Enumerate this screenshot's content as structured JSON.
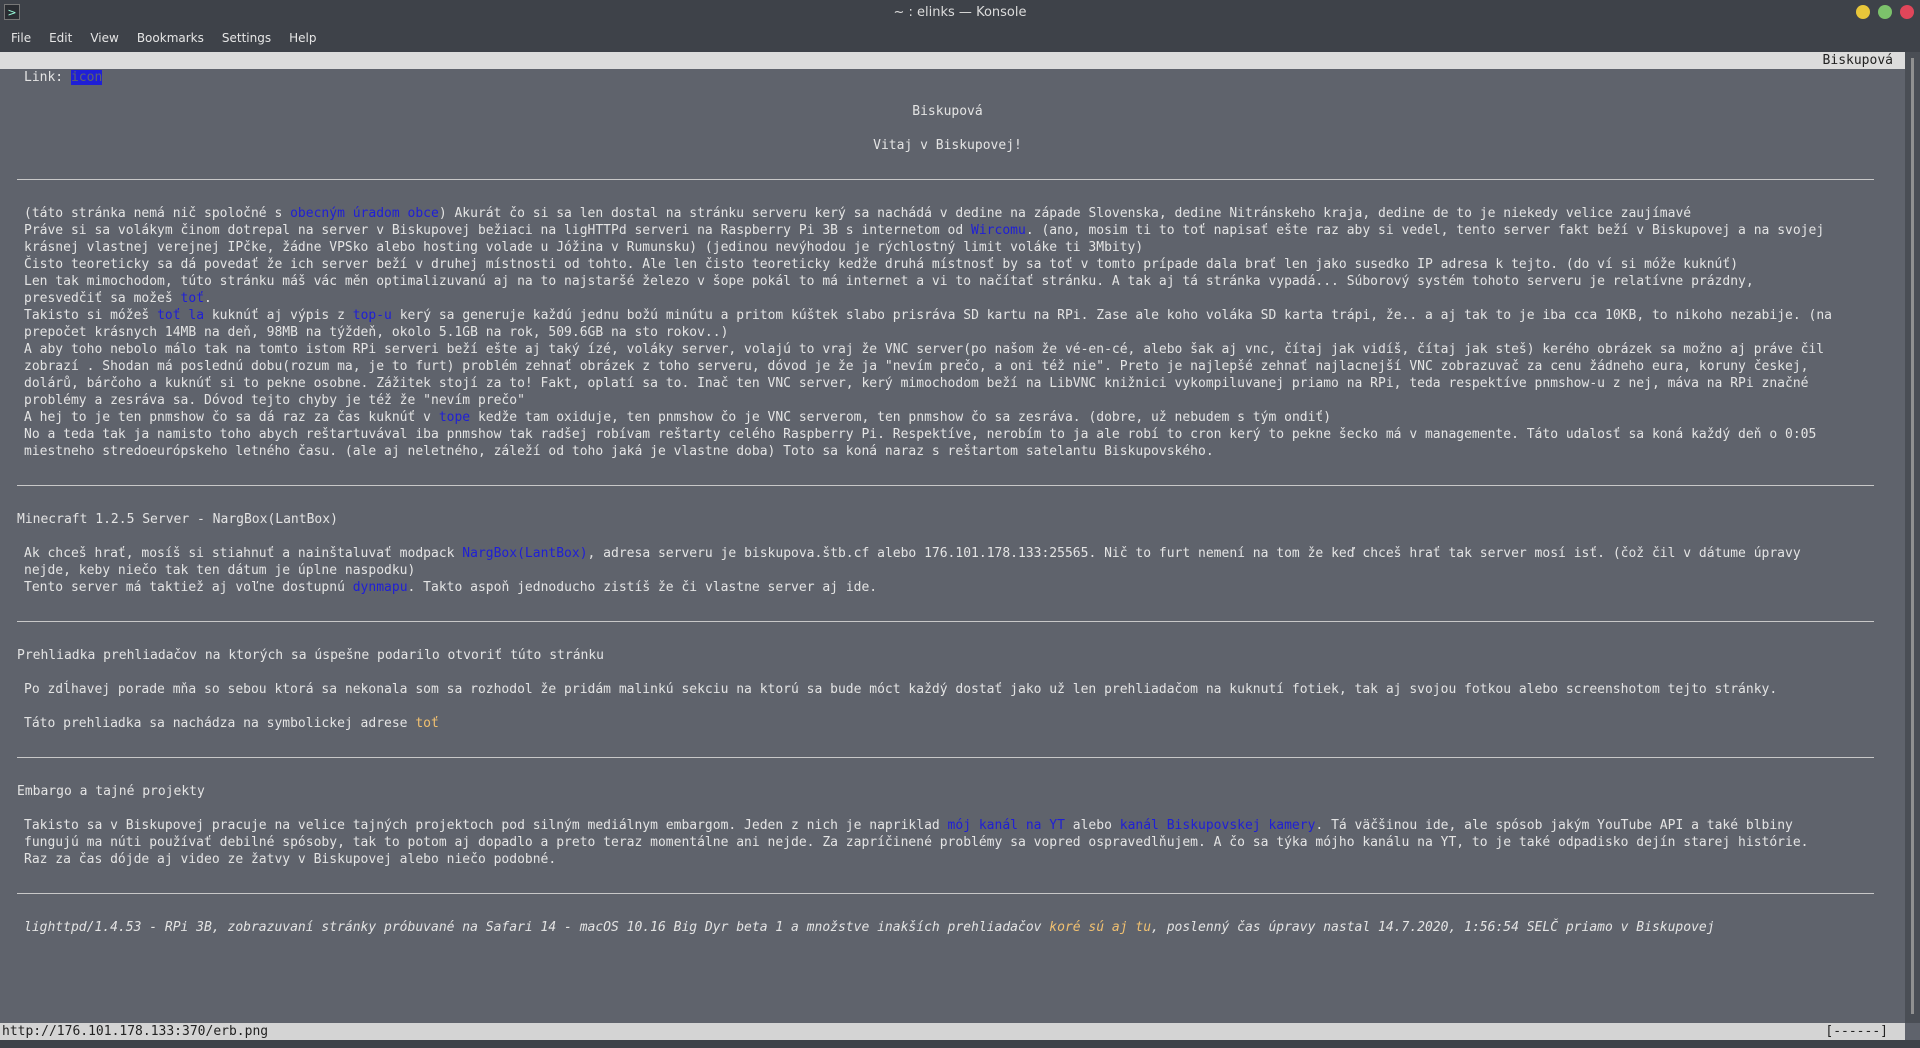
{
  "window": {
    "title": "~ : elinks — Konsole",
    "btn_colors": {
      "minimize": "#e8c63a",
      "maximize": "#7cc26b",
      "close": "#e0465a"
    }
  },
  "menu": [
    "File",
    "Edit",
    "View",
    "Bookmarks",
    "Settings",
    "Help"
  ],
  "elinks": {
    "doc_title": "Biskupová",
    "link_prefix": "Link: ",
    "link_value": "icon"
  },
  "page": {
    "heading": "Biskupová",
    "welcome": "Vitaj v Biskupovej!",
    "intro": {
      "l1_a": "(táto stránka nemá nič spoločné s ",
      "l1_link": "obecným úradom obce",
      "l1_b": ") Akurát čo si sa len dostal na stránku serveru kerý sa nachádá v dedine na západe Slovenska, dedine Nitránskeho kraja, dedine de to je niekedy velice zaujímavé",
      "l2_a": "Práve si sa volákym činom dotrepal na server v Biskupovej bežiaci na ligHTTPd serveri na Raspberry Pi 3B s internetom od ",
      "l2_link": "Wircomu",
      "l2_b": ". (ano, mosim ti to toť napisať ešte raz aby si vedel, tento server fakt beží v Biskupovej a na svojej",
      "l3": "krásnej vlastnej verejnej IPčke, žádne VPSko alebo hosting volade u Jóžina v Rumunsku) (jedinou nevýhodou je rýchlostný limit voláke ti 3Mbity)",
      "l4": "Čisto teoreticky sa dá povedať že ich server beží v druhej místnosti od tohto. Ale len čisto teoreticky kedže druhá místnosť by sa toť v tomto prípade dala brať len jako susedko IP adresa k tejto. (do ví si móže kuknúť)",
      "l5": "Len tak mimochodom, túto stránku máš vác měn optimalizuvanú aj na to najstaršé železo v šope pokál to má internet a vi to načítať stránku. A tak aj tá stránka vypadá... Súborový systém tohoto serveru je relatívne prázdny,",
      "l6_a": "presvedčiť sa možeš ",
      "l6_link": "toť",
      "l6_b": ".",
      "l7_a": "Takisto si móžeš ",
      "l7_link1": "toť la",
      "l7_b": " kuknúť aj výpis z ",
      "l7_link2": "top-u",
      "l7_c": " kerý sa generuje každú jednu božú minútu a pritom kúštek slabo prisráva SD kartu na RPi. Zase ale koho voláka SD karta trápi, že.. a aj tak to je iba cca 10KB, to nikoho nezabije. (na",
      "l8": "prepočet krásnych 14MB na deň, 98MB na týždeň, okolo 5.1GB na rok, 509.6GB na sto rokov..)",
      "l9": "A aby toho nebolo málo tak na tomto istom RPi serveri beží ešte aj taký ízé, voláky server, volajú to vraj že VNC server(po našom že vé-en-cé, alebo šak aj vnc, čítaj jak vidíš, čítaj jak steš) kerého obrázek sa možno aj práve čil",
      "l10": "zobrazí . Shodan má poslednú dobu(rozum ma, je to furt) problém zehnať obrázek z toho serveru, dóvod je že ja \"nevím prečo, a oni též nie\". Preto je najlepšé zehnať najlacnejší VNC zobrazuvač za cenu žádneho eura, koruny českej,",
      "l11": "dolárů, bárčoho a kuknúť si to pekne osobne. Zážitek stojí za to! Fakt, oplatí sa to. Inač ten VNC server, kerý mimochodom beží na LibVNC knižnici vykompiluvanej priamo na RPi, teda respektíve pnmshow-u z nej, máva na RPi značné",
      "l12": "problémy a zesráva sa. Dóvod tejto chyby je též že \"nevím prečo\"",
      "l13_a": "A hej to je ten pnmshow čo sa dá raz za čas kuknúť v ",
      "l13_link": "tope",
      "l13_b": " kedže tam oxiduje, ten pnmshow čo je VNC serverom, ten pnmshow čo sa zesráva. (dobre, už nebudem s tým ondiť)",
      "l14": "No a teda tak ja namisto toho abych reštartuvával iba pnmshow tak radšej robívam reštarty celého Raspberry Pi. Respektíve, nerobím to ja ale robí to cron kerý to pekne šecko má v managemente. Táto udalosť sa koná každý deň o 0:05",
      "l15": "miestneho stredoeurópskeho letného času. (ale aj neletného, záleží od toho jaká je vlastne doba) Toto sa koná naraz s reštartom satelantu Biskupovského."
    },
    "minecraft": {
      "heading": "Minecraft 1.2.5 Server - NargBox(LantBox)",
      "l1_a": "Ak chceš hrať, mosíš si stiahnuť a nainštaluvať modpack ",
      "l1_link": "NargBox(LantBox)",
      "l1_b": ", adresa serveru je biskupova.štb.cf alebo 176.101.178.133:25565. Nič to furt nemení na tom že keď chceš hrať tak server mosí isť. (čož čil v dátume úpravy",
      "l2": "nejde, keby niečo tak ten dátum je úplne naspodku)",
      "l3_a": "Tento server má taktiež aj voľne dostupnú ",
      "l3_link": "dynmapu",
      "l3_b": ". Takto aspoň jednoducho zistíš že či vlastne server aj ide."
    },
    "browsers": {
      "heading": "Prehliadka prehliadačov na ktorých sa úspešne podarilo otvoriť túto stránku",
      "l1": "Po zdĺhavej porade mňa so sebou ktorá sa nekonala som sa rozhodol že pridám malinkú sekciu na ktorú sa bude móct každý dostať jako už len prehliadačom na kuknutí fotiek, tak aj svojou fotkou alebo screenshotom tejto stránky.",
      "l2_a": "Táto prehliadka sa nachádza na symbolickej adrese ",
      "l2_link": "toť"
    },
    "embargo": {
      "heading": "Embargo a tajné projekty",
      "l1_a": "Takisto sa v Biskupovej pracuje na velice tajných projektoch pod silným mediálnym embargom. Jeden z nich je napriklad ",
      "l1_link1": "mój kanál na YT",
      "l1_b": " alebo ",
      "l1_link2": "kanál Biskupovskej kamery",
      "l1_c": ". Tá väčšinou ide, ale spósob jakým YouTube API a také blbiny",
      "l2": "fungujú ma núti používať debilné spósoby, tak to potom aj dopadlo a preto teraz momentálne ani nejde. Za zapríčinené problémy sa vopred ospravedlňujem. A čo sa týka mójho kanálu na YT, to je také odpadisko dejín starej histórie.",
      "l3": "Raz za čas dójde aj video ze žatvy v Biskupovej alebo niečo podobné."
    },
    "footer": {
      "a": "lighttpd/1.4.53 - RPi 3B, zobrazuvaní stránky próbuvané na Safari 14 - macOS 10.16 Big Dyr beta 1 a množstve inakších prehliadačov ",
      "link": "koré sú aj tu",
      "b": ", poslenný čas úpravy nastal 14.7.2020, 1:56:54 SELČ priamo v Biskupovej"
    }
  },
  "statusbar": {
    "url": "http://176.101.178.133:370/erb.png",
    "progress": "[------]"
  }
}
